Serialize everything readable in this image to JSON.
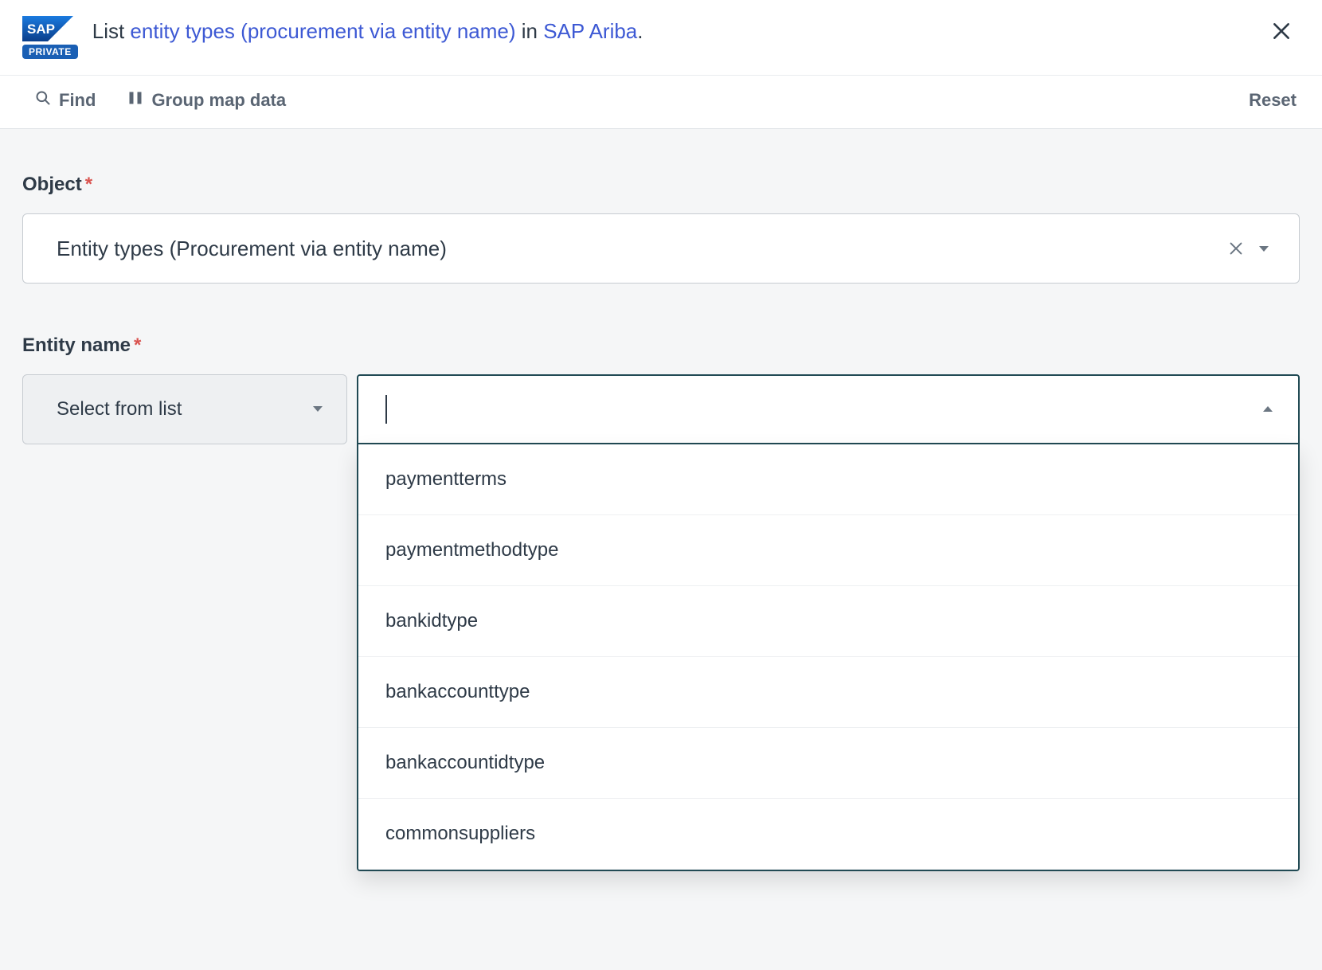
{
  "header": {
    "logo_text": "SAP",
    "private_label": "PRIVATE",
    "title_prefix": "List ",
    "title_link1": "entity types (procurement via entity name)",
    "title_mid": " in ",
    "title_link2": "SAP Ariba",
    "title_suffix": "."
  },
  "toolbar": {
    "find_label": "Find",
    "group_label": "Group map data",
    "reset_label": "Reset"
  },
  "object_field": {
    "label": "Object",
    "value": "Entity types (Procurement via entity name)"
  },
  "entity_field": {
    "label": "Entity name",
    "mode_label": "Select from list",
    "options": [
      "paymentterms",
      "paymentmethodtype",
      "bankidtype",
      "bankaccounttype",
      "bankaccountidtype",
      "commonsuppliers"
    ]
  },
  "required_marker": "*"
}
